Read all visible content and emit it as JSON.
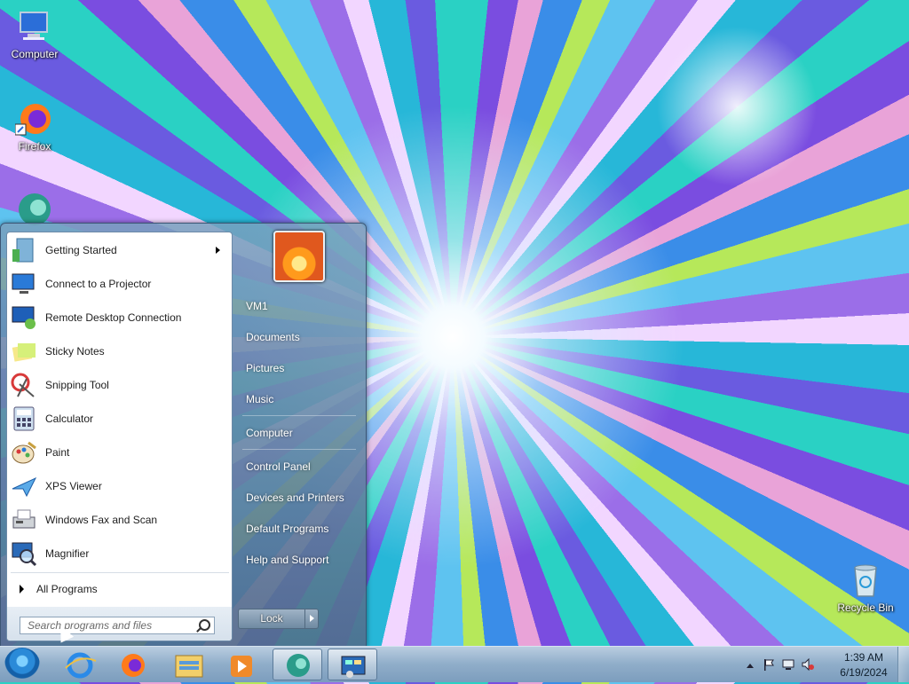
{
  "desktop": {
    "icons": [
      {
        "label": "Computer",
        "icon": "computer-icon"
      },
      {
        "label": "Firefox",
        "icon": "firefox-icon"
      },
      {
        "label": "Recycle Bin",
        "icon": "recycle-bin-icon"
      }
    ]
  },
  "start_menu": {
    "programs": [
      {
        "label": "Getting Started",
        "icon": "getting-started-icon",
        "has_submenu": true
      },
      {
        "label": "Connect to a Projector",
        "icon": "projector-icon"
      },
      {
        "label": "Remote Desktop Connection",
        "icon": "remote-desktop-icon"
      },
      {
        "label": "Sticky Notes",
        "icon": "sticky-notes-icon"
      },
      {
        "label": "Snipping Tool",
        "icon": "snipping-tool-icon"
      },
      {
        "label": "Calculator",
        "icon": "calculator-icon"
      },
      {
        "label": "Paint",
        "icon": "paint-icon"
      },
      {
        "label": "XPS Viewer",
        "icon": "xps-viewer-icon"
      },
      {
        "label": "Windows Fax and Scan",
        "icon": "fax-scan-icon"
      },
      {
        "label": "Magnifier",
        "icon": "magnifier-icon"
      }
    ],
    "all_programs": "All Programs",
    "search": {
      "placeholder": "Search programs and files"
    },
    "right_links": [
      "VM1",
      "Documents",
      "Pictures",
      "Music",
      "Computer",
      "Control Panel",
      "Devices and Printers",
      "Default Programs",
      "Help and Support"
    ],
    "lock_label": "Lock"
  },
  "taskbar": {
    "items": [
      "start-orb-icon",
      "internet-explorer-icon",
      "firefox-icon",
      "windows-explorer-icon",
      "media-player-icon",
      "app-sphere-icon",
      "control-panel-icon"
    ],
    "tray": {
      "time": "1:39 AM",
      "date": "6/19/2024"
    }
  },
  "colors": {
    "taskbar": "#8fadc9",
    "accent": "#2a8ad8"
  }
}
